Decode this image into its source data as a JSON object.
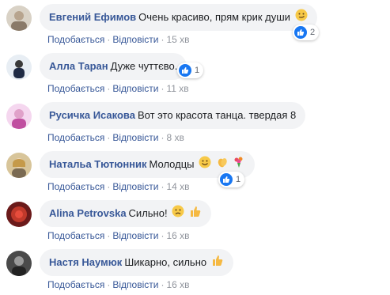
{
  "comments": [
    {
      "author": "Евгений Ефимов",
      "text": "Очень красиво, прям крик души",
      "time": "15 хв",
      "reaction_count": "2"
    },
    {
      "author": "Алла Таран",
      "text": "Дуже чуттєво.",
      "time": "11 хв",
      "reaction_count": "1"
    },
    {
      "author": "Русичка Исакова",
      "text": "Вот это красота танца. твердая 8",
      "time": "8 хв"
    },
    {
      "author": "Натальа Тютюнник",
      "text": "Молодцы",
      "time": "14 хв",
      "reaction_count": "1"
    },
    {
      "author": "Alina Petrovska",
      "text": "Сильно!",
      "time": "16 хв"
    },
    {
      "author": "Настя Наумюк",
      "text": "Шикарно, сильно",
      "time": "16 хв"
    }
  ],
  "actions": {
    "like_label": "Подобається",
    "reply_label": "Відповісти",
    "separator": "·"
  },
  "colors": {
    "author": "#385898",
    "meta": "#90949c",
    "bubble": "#f2f3f5",
    "like": "#1877f2"
  }
}
